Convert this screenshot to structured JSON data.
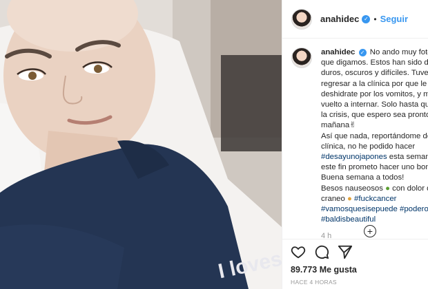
{
  "post": {
    "username": "anahidec",
    "verified_icon": "verified-badge-icon",
    "separator": "•",
    "follow_label": "Seguir",
    "photo_text": "I loves"
  },
  "caption": {
    "username": "anahidec",
    "lines": [
      "No ando muy fotogé",
      "que digamos. Estos han sido días",
      "duros, oscuros y difíciles. Tuve qu",
      "regresar a la clínica por que le",
      "deshidrate por los vomitos, y me",
      "vuelto a internar. Solo hasta que p",
      "la crisis, que espero sea pronto ",
      "mañana",
      "Así que nada, reportándome desd",
      "clínica, no he podido hacer",
      "#desayunojapones",
      " esta semana p",
      "este fin prometo hacer uno bonito",
      "Buena semana a todos!",
      "Besos nauseosos ",
      " con dolor de",
      "craneo ",
      " #fuckcancer",
      "#vamosquesisepuede",
      " #poderosa",
      "#baldisbeautiful"
    ],
    "time": "4 h"
  },
  "icons": {
    "like": "heart-icon",
    "comment": "comment-icon",
    "share": "share-icon",
    "more_comments": "plus-circle-icon",
    "emoji1": "crossed-fingers-emoji",
    "emoji2": "nauseated-face-emoji",
    "emoji3": "pouting-face-emoji"
  },
  "likes": "89.773 Me gusta",
  "ago": "HACE 4 HORAS",
  "load_more_symbol": "+"
}
